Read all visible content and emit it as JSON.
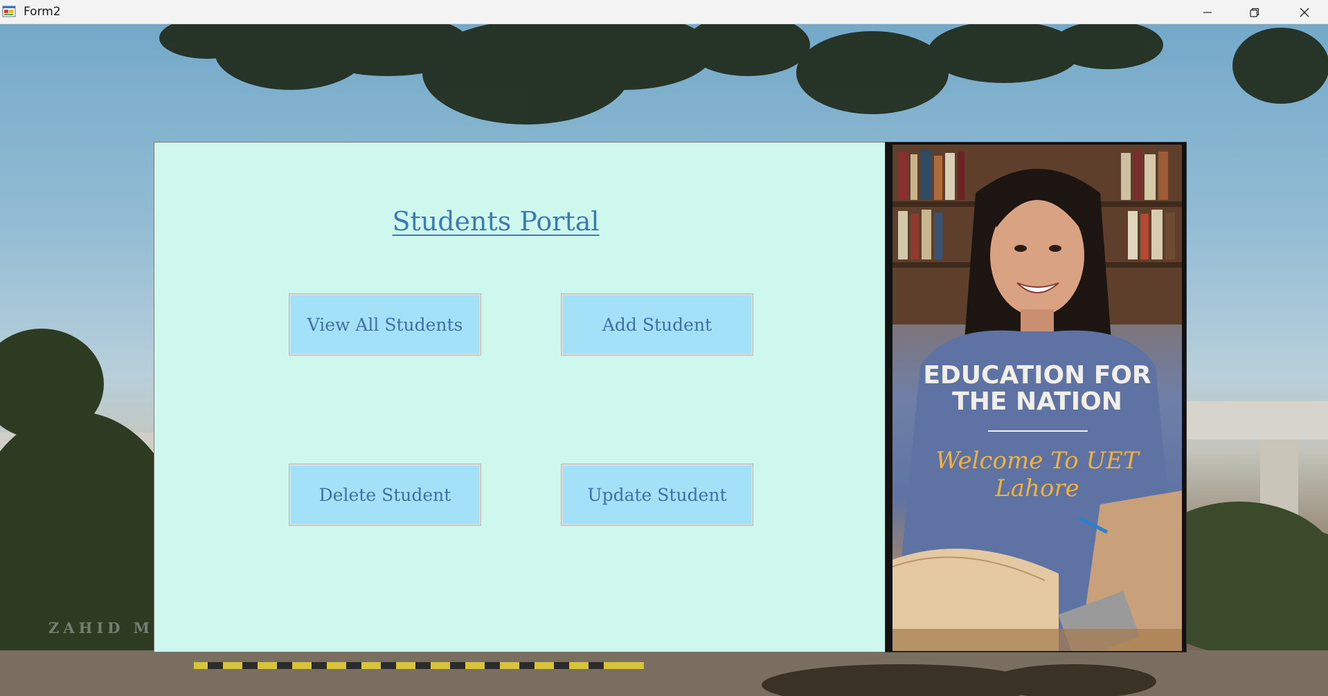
{
  "window": {
    "title": "Form2",
    "controls": {
      "minimize_icon": "minimize-icon",
      "maximize_icon": "restore-icon",
      "close_icon": "close-icon"
    }
  },
  "background": {
    "watermark": "ZAHID M"
  },
  "panel": {
    "title": "Students Portal",
    "buttons": {
      "view_all": "View All Students",
      "add": "Add Student",
      "delete": "Delete Student",
      "update": "Update Student"
    }
  },
  "poster": {
    "headline": "EDUCATION FOR\nTHE NATION",
    "welcome": "Welcome To UET Lahore"
  },
  "colors": {
    "panel_bg": "#cef7ee",
    "button_bg": "#a3e1f9",
    "title_color": "#3d7ab2",
    "button_text": "#3f6fa6",
    "welcome_color": "#f0b23a"
  }
}
